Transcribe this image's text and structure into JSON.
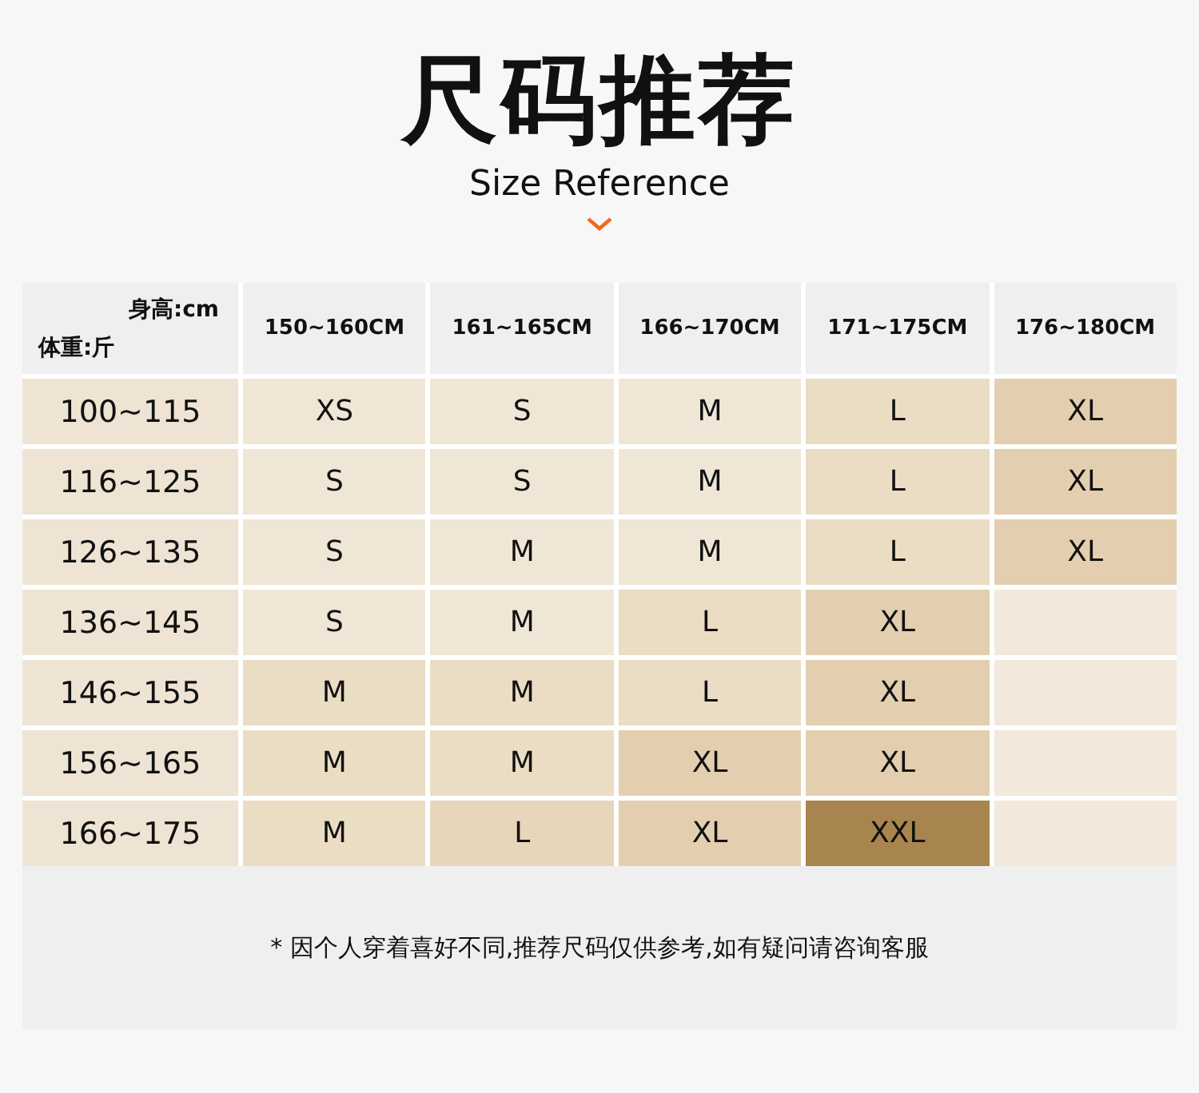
{
  "title": "尺码推荐",
  "subtitle": "Size Reference",
  "table": {
    "corner": {
      "height_label": "身高:cm",
      "weight_label": "体重:斤"
    },
    "columns": [
      "150~160CM",
      "161~165CM",
      "166~170CM",
      "171~175CM",
      "176~180CM"
    ],
    "rows": [
      {
        "weight": "100~115",
        "cells": [
          {
            "text": "XS",
            "color": "#f0e6d6"
          },
          {
            "text": "S",
            "color": "#f0e6d6"
          },
          {
            "text": "M",
            "color": "#f0e6d6"
          },
          {
            "text": "L",
            "color": "#ebdcc4"
          },
          {
            "text": "XL",
            "color": "#e3cfb0"
          }
        ]
      },
      {
        "weight": "116~125",
        "cells": [
          {
            "text": "S",
            "color": "#f0e6d6"
          },
          {
            "text": "S",
            "color": "#f0e6d6"
          },
          {
            "text": "M",
            "color": "#f0e6d6"
          },
          {
            "text": "L",
            "color": "#ebdcc4"
          },
          {
            "text": "XL",
            "color": "#e3cfb0"
          }
        ]
      },
      {
        "weight": "126~135",
        "cells": [
          {
            "text": "S",
            "color": "#f0e6d6"
          },
          {
            "text": "M",
            "color": "#f0e6d6"
          },
          {
            "text": "M",
            "color": "#f0e6d6"
          },
          {
            "text": "L",
            "color": "#ebdcc4"
          },
          {
            "text": "XL",
            "color": "#e3cfb0"
          }
        ]
      },
      {
        "weight": "136~145",
        "cells": [
          {
            "text": "S",
            "color": "#f0e6d6"
          },
          {
            "text": "M",
            "color": "#f0e6d6"
          },
          {
            "text": "L",
            "color": "#ebdcc4"
          },
          {
            "text": "XL",
            "color": "#e3cfb0"
          },
          {
            "color": "#f2e9dc"
          }
        ]
      },
      {
        "weight": "146~155",
        "cells": [
          {
            "text": "M",
            "color": "#ebdcc4"
          },
          {
            "text": "M",
            "color": "#ebdcc4"
          },
          {
            "text": "L",
            "color": "#ebdcc4"
          },
          {
            "text": "XL",
            "color": "#e3cfb0"
          },
          {
            "color": "#f2e9dc"
          }
        ]
      },
      {
        "weight": "156~165",
        "cells": [
          {
            "text": "M",
            "color": "#ebdcc4"
          },
          {
            "text": "M",
            "color": "#ebdcc4"
          },
          {
            "text": "XL",
            "color": "#e3cfb0"
          },
          {
            "text": "XL",
            "color": "#e3cfb0"
          },
          {
            "color": "#f2e9dc"
          }
        ]
      },
      {
        "weight": "166~175",
        "cells": [
          {
            "text": "M",
            "color": "#ebdcc4"
          },
          {
            "text": "L",
            "color": "#e8d6bb"
          },
          {
            "text": "XL",
            "color": "#e3cfb0"
          },
          {
            "text": "XXL",
            "color": "#a8854f"
          },
          {
            "color": "#f2e9dc"
          }
        ]
      }
    ]
  },
  "note": "* 因个人穿着喜好不同,推荐尺码仅供参考,如有疑问请咨询客服"
}
